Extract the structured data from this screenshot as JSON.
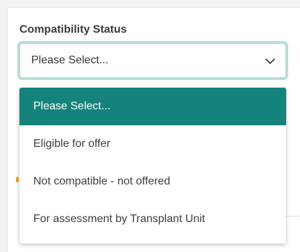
{
  "field": {
    "label": "Compatibility Status",
    "selected_value": "Please Select...",
    "chevron_icon": "chevron-down-icon"
  },
  "dropdown": {
    "options": [
      "Please Select...",
      "Eligible for offer",
      "Not compatible - not offered",
      "For assessment by Transplant Unit"
    ],
    "highlighted_index": 0
  },
  "colors": {
    "highlight_bg": "#14837c",
    "focus_ring": "#b5e0dc",
    "label_text": "#3a3a3a"
  }
}
